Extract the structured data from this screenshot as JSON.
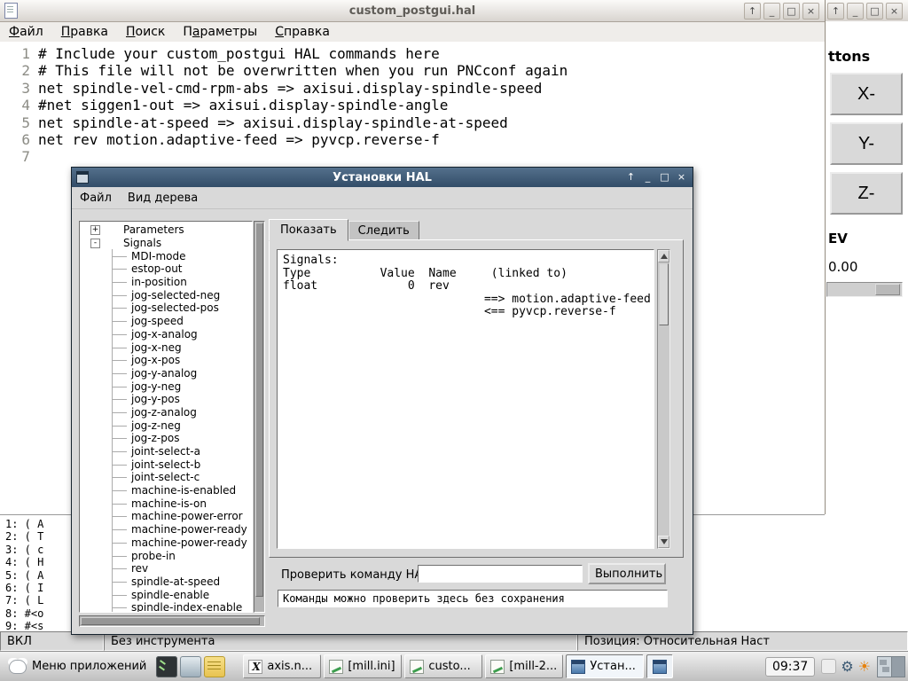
{
  "window_controls": [
    {
      "name": "shade-button",
      "glyph": "↑"
    },
    {
      "name": "minimize-button",
      "glyph": "_"
    },
    {
      "name": "maximize-button",
      "glyph": "□"
    },
    {
      "name": "close-button",
      "glyph": "×"
    }
  ],
  "editor": {
    "title": "custom_postgui.hal",
    "menu": [
      {
        "pre": "",
        "u": "Ф",
        "post": "айл"
      },
      {
        "pre": "",
        "u": "П",
        "post": "равка"
      },
      {
        "pre": "",
        "u": "П",
        "post": "оиск"
      },
      {
        "pre": "П",
        "u": "а",
        "post": "раметры"
      },
      {
        "pre": "",
        "u": "С",
        "post": "правка"
      }
    ],
    "lines": [
      {
        "n": "1",
        "t": "# Include your custom_postgui HAL commands here"
      },
      {
        "n": "2",
        "t": "# This file will not be overwritten when you run PNCconf again"
      },
      {
        "n": "3",
        "t": "net spindle-vel-cmd-rpm-abs => axisui.display-spindle-speed"
      },
      {
        "n": "4",
        "t": "#net siggen1-out => axisui.display-spindle-angle"
      },
      {
        "n": "5",
        "t": "net spindle-at-speed => axisui.display-spindle-at-speed"
      },
      {
        "n": "6",
        "t": "net rev motion.adaptive-feed => pyvcp.reverse-f"
      },
      {
        "n": "7",
        "t": ""
      }
    ]
  },
  "side_panel": {
    "heading": "ttons",
    "jog_buttons": [
      "X-",
      "Y-",
      "Z-"
    ],
    "rev_label": "EV",
    "rev_value": "0.00"
  },
  "hal_dialog": {
    "title": "Установки HAL",
    "menu": [
      "Файл",
      "Вид дерева"
    ],
    "tabs": [
      {
        "label": "Показать",
        "state": "active"
      },
      {
        "label": "Следить",
        "state": "inactive"
      }
    ],
    "tree": [
      {
        "label": "Parameters",
        "kind": "branch",
        "expander": "+"
      },
      {
        "label": "Signals",
        "kind": "branch",
        "expander": "-"
      },
      {
        "label": "MDI-mode",
        "kind": "leaf",
        "expander": ""
      },
      {
        "label": "estop-out",
        "kind": "leaf",
        "expander": ""
      },
      {
        "label": "in-position",
        "kind": "leaf",
        "expander": ""
      },
      {
        "label": "jog-selected-neg",
        "kind": "leaf",
        "expander": ""
      },
      {
        "label": "jog-selected-pos",
        "kind": "leaf",
        "expander": ""
      },
      {
        "label": "jog-speed",
        "kind": "leaf",
        "expander": ""
      },
      {
        "label": "jog-x-analog",
        "kind": "leaf",
        "expander": ""
      },
      {
        "label": "jog-x-neg",
        "kind": "leaf",
        "expander": ""
      },
      {
        "label": "jog-x-pos",
        "kind": "leaf",
        "expander": ""
      },
      {
        "label": "jog-y-analog",
        "kind": "leaf",
        "expander": ""
      },
      {
        "label": "jog-y-neg",
        "kind": "leaf",
        "expander": ""
      },
      {
        "label": "jog-y-pos",
        "kind": "leaf",
        "expander": ""
      },
      {
        "label": "jog-z-analog",
        "kind": "leaf",
        "expander": ""
      },
      {
        "label": "jog-z-neg",
        "kind": "leaf",
        "expander": ""
      },
      {
        "label": "jog-z-pos",
        "kind": "leaf",
        "expander": ""
      },
      {
        "label": "joint-select-a",
        "kind": "leaf",
        "expander": ""
      },
      {
        "label": "joint-select-b",
        "kind": "leaf",
        "expander": ""
      },
      {
        "label": "joint-select-c",
        "kind": "leaf",
        "expander": ""
      },
      {
        "label": "machine-is-enabled",
        "kind": "leaf",
        "expander": ""
      },
      {
        "label": "machine-is-on",
        "kind": "leaf",
        "expander": ""
      },
      {
        "label": "machine-power-error",
        "kind": "leaf",
        "expander": ""
      },
      {
        "label": "machine-power-ready",
        "kind": "leaf",
        "expander": ""
      },
      {
        "label": "machine-power-ready",
        "kind": "leaf",
        "expander": ""
      },
      {
        "label": "probe-in",
        "kind": "leaf",
        "expander": ""
      },
      {
        "label": "rev",
        "kind": "leaf",
        "expander": ""
      },
      {
        "label": "spindle-at-speed",
        "kind": "leaf",
        "expander": ""
      },
      {
        "label": "spindle-enable",
        "kind": "leaf",
        "expander": ""
      },
      {
        "label": "spindle-index-enable",
        "kind": "leaf",
        "expander": ""
      }
    ],
    "output_lines": [
      "Signals:",
      "Type          Value  Name     (linked to)",
      "float             0  rev",
      "                             ==> motion.adaptive-feed",
      "                             <== pyvcp.reverse-f"
    ],
    "command_label": "Проверить команду HAL:",
    "command_value": "",
    "execute_button": "Выполнить",
    "hint": "Команды можно проверить здесь без сохранения"
  },
  "gcode": {
    "lines": [
      "1: ( A",
      "2: ( T",
      "3: ( c",
      "4: ( H",
      "5: ( A",
      "6: ( I",
      "7: ( L",
      "8: #<o",
      "9: #<s"
    ]
  },
  "statusbar": {
    "machine_state": "ВКЛ",
    "tool": "Без инструмента",
    "position": "Позиция: Относительная Наст"
  },
  "taskbar": {
    "menu_label": "Меню приложений",
    "tasks": [
      {
        "label": "axis.n...",
        "icon": "xorg",
        "state": "normal"
      },
      {
        "label": "[mill.ini]",
        "icon": "editor",
        "state": "normal"
      },
      {
        "label": "custo...",
        "icon": "editor",
        "state": "normal"
      },
      {
        "label": "[mill-2...",
        "icon": "editor",
        "state": "normal"
      },
      {
        "label": "Устан...",
        "icon": "window",
        "state": "active"
      }
    ],
    "clock": "09:37"
  },
  "icons": {
    "gear": "⚙",
    "sun": "☀"
  }
}
